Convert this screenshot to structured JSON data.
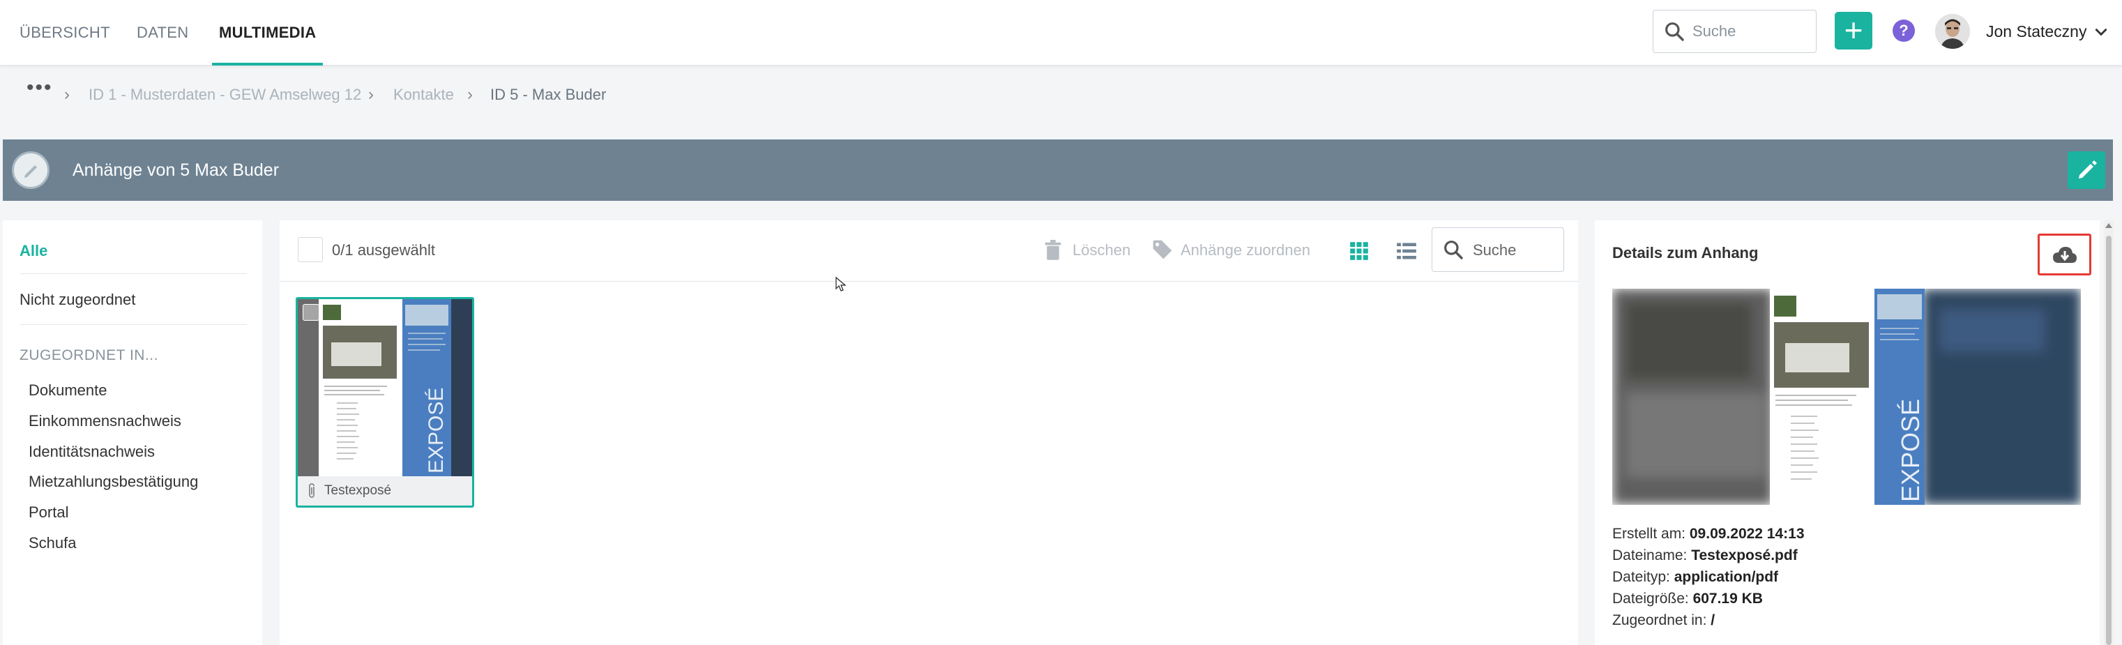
{
  "nav": {
    "tabs": [
      {
        "label": "ÜBERSICHT",
        "active": false
      },
      {
        "label": "DATEN",
        "active": false
      },
      {
        "label": "MULTIMEDIA",
        "active": true
      }
    ],
    "search_placeholder": "Suche",
    "add_label": "+",
    "help_label": "?",
    "user_name": "Jon Stateczny",
    "accent_color": "#19b3a0"
  },
  "breadcrumb": {
    "more_label": "•••",
    "items": [
      "ID 1 - Musterdaten - GEW Amselweg 12",
      "Kontakte"
    ],
    "current": "ID 5 - Max Buder"
  },
  "header": {
    "title": "Anhänge von 5 Max Buder",
    "bar_color": "#6e8292"
  },
  "sidebar": {
    "items": [
      "Alle",
      "Nicht zugeordnet"
    ],
    "active_item": "Alle",
    "group_heading": "ZUGEORDNET IN...",
    "groups": [
      "Dokumente",
      "Einkommensnachweis",
      "Identitätsnachweis",
      "Mietzahlungsbestätigung",
      "Portal",
      "Schufa"
    ]
  },
  "toolbar": {
    "selection_count": "0/1 ausgewählt",
    "delete_label": "Löschen",
    "assign_label": "Anhänge zuordnen",
    "search_placeholder": "Suche"
  },
  "attachments": [
    {
      "name": "Testexposé",
      "selected": true
    }
  ],
  "thumbnail": {
    "vertical_text": "EXPOSÉ"
  },
  "details": {
    "title": "Details zum Anhang",
    "fields": [
      {
        "label": "Erstellt am:",
        "value": "09.09.2022 14:13"
      },
      {
        "label": "Dateiname:",
        "value": "Testexposé.pdf"
      },
      {
        "label": "Dateityp:",
        "value": "application/pdf"
      },
      {
        "label": "Dateigröße:",
        "value": "607.19 KB"
      },
      {
        "label": "Zugeordnet in:",
        "value": "/"
      }
    ]
  }
}
